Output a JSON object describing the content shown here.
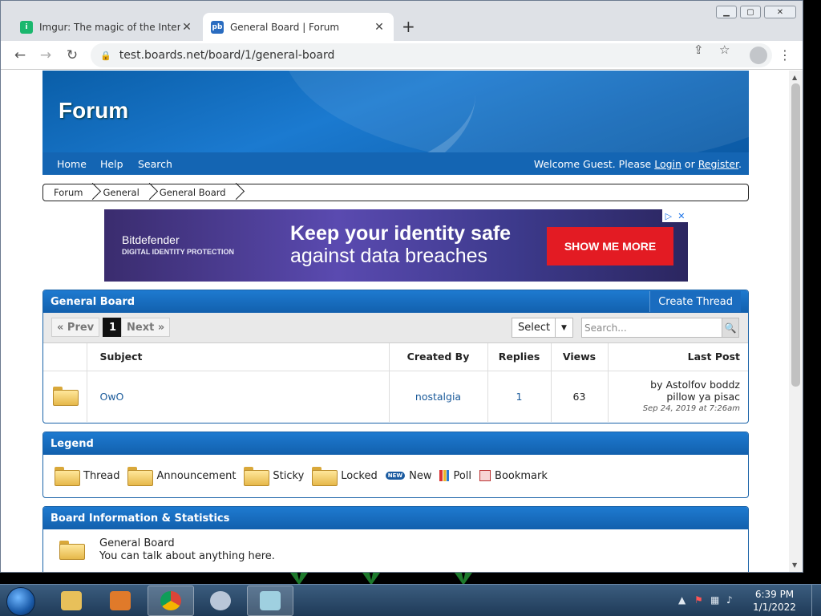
{
  "browser": {
    "tabs": [
      {
        "title": "Imgur: The magic of the Internet",
        "favicon": "imgur-icon",
        "active": false
      },
      {
        "title": "General Board | Forum",
        "favicon": "pb-icon",
        "active": true
      }
    ],
    "url": "test.boards.net/board/1/general-board"
  },
  "forum": {
    "site_title": "Forum",
    "nav": [
      "Home",
      "Help",
      "Search"
    ],
    "welcome_prefix": "Welcome Guest. Please ",
    "login": "Login",
    "or": " or ",
    "register": "Register",
    "period": ".",
    "breadcrumbs": [
      "Forum",
      "General",
      "General Board"
    ],
    "ad": {
      "brand": "Bitdefender",
      "sub": "DIGITAL IDENTITY PROTECTION",
      "headline1": "Keep your identity safe",
      "headline2": "against data breaches",
      "cta": "SHOW ME MORE"
    },
    "board": {
      "title": "General Board",
      "create_thread": "Create Thread",
      "pager": {
        "prev": "« Prev",
        "current": "1",
        "next": "Next »"
      },
      "select": "Select",
      "search_placeholder": "Search...",
      "columns": [
        "Subject",
        "Created By",
        "Replies",
        "Views",
        "Last Post"
      ],
      "threads": [
        {
          "subject": "OwO",
          "created_by": "nostalgia",
          "replies": "1",
          "views": "63",
          "last_post_by": "by Astolfov boddz pillow ya pisac",
          "last_post_date": "Sep 24, 2019 at 7:26am"
        }
      ]
    },
    "legend": {
      "title": "Legend",
      "items": [
        "Thread",
        "Announcement",
        "Sticky",
        "Locked",
        "New",
        "Poll",
        "Bookmark"
      ],
      "new_badge": "NEW"
    },
    "info": {
      "title": "Board Information & Statistics",
      "board_name": "General Board",
      "board_desc": "You can talk about anything here."
    }
  },
  "taskbar": {
    "time": "6:39 PM",
    "date": "1/1/2022"
  }
}
